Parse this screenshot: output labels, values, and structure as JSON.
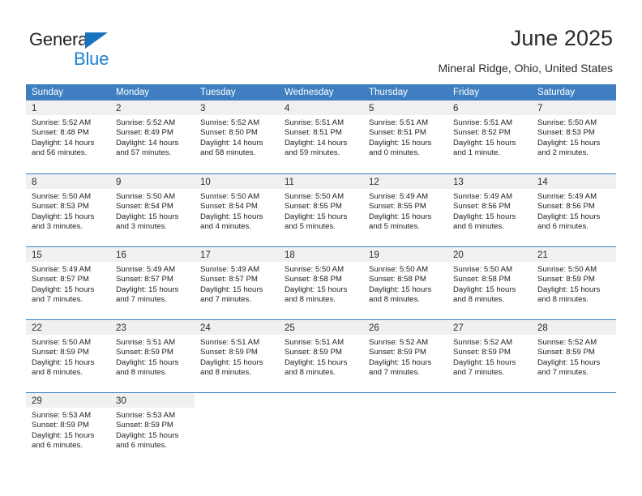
{
  "brand": {
    "name_part1": "General",
    "name_part2": "Blue",
    "logo_icon": "triangle-logo-icon"
  },
  "header": {
    "title": "June 2025",
    "subtitle": "Mineral Ridge, Ohio, United States"
  },
  "colors": {
    "header_blue": "#3f7fc1",
    "brand_blue": "#1b82d2",
    "daynum_band": "#f0f0f0",
    "text": "#222222"
  },
  "weekdays": [
    "Sunday",
    "Monday",
    "Tuesday",
    "Wednesday",
    "Thursday",
    "Friday",
    "Saturday"
  ],
  "weeks": [
    [
      {
        "day": "1",
        "sunrise": "Sunrise: 5:52 AM",
        "sunset": "Sunset: 8:48 PM",
        "daylight_1": "Daylight: 14 hours",
        "daylight_2": "and 56 minutes."
      },
      {
        "day": "2",
        "sunrise": "Sunrise: 5:52 AM",
        "sunset": "Sunset: 8:49 PM",
        "daylight_1": "Daylight: 14 hours",
        "daylight_2": "and 57 minutes."
      },
      {
        "day": "3",
        "sunrise": "Sunrise: 5:52 AM",
        "sunset": "Sunset: 8:50 PM",
        "daylight_1": "Daylight: 14 hours",
        "daylight_2": "and 58 minutes."
      },
      {
        "day": "4",
        "sunrise": "Sunrise: 5:51 AM",
        "sunset": "Sunset: 8:51 PM",
        "daylight_1": "Daylight: 14 hours",
        "daylight_2": "and 59 minutes."
      },
      {
        "day": "5",
        "sunrise": "Sunrise: 5:51 AM",
        "sunset": "Sunset: 8:51 PM",
        "daylight_1": "Daylight: 15 hours",
        "daylight_2": "and 0 minutes."
      },
      {
        "day": "6",
        "sunrise": "Sunrise: 5:51 AM",
        "sunset": "Sunset: 8:52 PM",
        "daylight_1": "Daylight: 15 hours",
        "daylight_2": "and 1 minute."
      },
      {
        "day": "7",
        "sunrise": "Sunrise: 5:50 AM",
        "sunset": "Sunset: 8:53 PM",
        "daylight_1": "Daylight: 15 hours",
        "daylight_2": "and 2 minutes."
      }
    ],
    [
      {
        "day": "8",
        "sunrise": "Sunrise: 5:50 AM",
        "sunset": "Sunset: 8:53 PM",
        "daylight_1": "Daylight: 15 hours",
        "daylight_2": "and 3 minutes."
      },
      {
        "day": "9",
        "sunrise": "Sunrise: 5:50 AM",
        "sunset": "Sunset: 8:54 PM",
        "daylight_1": "Daylight: 15 hours",
        "daylight_2": "and 3 minutes."
      },
      {
        "day": "10",
        "sunrise": "Sunrise: 5:50 AM",
        "sunset": "Sunset: 8:54 PM",
        "daylight_1": "Daylight: 15 hours",
        "daylight_2": "and 4 minutes."
      },
      {
        "day": "11",
        "sunrise": "Sunrise: 5:50 AM",
        "sunset": "Sunset: 8:55 PM",
        "daylight_1": "Daylight: 15 hours",
        "daylight_2": "and 5 minutes."
      },
      {
        "day": "12",
        "sunrise": "Sunrise: 5:49 AM",
        "sunset": "Sunset: 8:55 PM",
        "daylight_1": "Daylight: 15 hours",
        "daylight_2": "and 5 minutes."
      },
      {
        "day": "13",
        "sunrise": "Sunrise: 5:49 AM",
        "sunset": "Sunset: 8:56 PM",
        "daylight_1": "Daylight: 15 hours",
        "daylight_2": "and 6 minutes."
      },
      {
        "day": "14",
        "sunrise": "Sunrise: 5:49 AM",
        "sunset": "Sunset: 8:56 PM",
        "daylight_1": "Daylight: 15 hours",
        "daylight_2": "and 6 minutes."
      }
    ],
    [
      {
        "day": "15",
        "sunrise": "Sunrise: 5:49 AM",
        "sunset": "Sunset: 8:57 PM",
        "daylight_1": "Daylight: 15 hours",
        "daylight_2": "and 7 minutes."
      },
      {
        "day": "16",
        "sunrise": "Sunrise: 5:49 AM",
        "sunset": "Sunset: 8:57 PM",
        "daylight_1": "Daylight: 15 hours",
        "daylight_2": "and 7 minutes."
      },
      {
        "day": "17",
        "sunrise": "Sunrise: 5:49 AM",
        "sunset": "Sunset: 8:57 PM",
        "daylight_1": "Daylight: 15 hours",
        "daylight_2": "and 7 minutes."
      },
      {
        "day": "18",
        "sunrise": "Sunrise: 5:50 AM",
        "sunset": "Sunset: 8:58 PM",
        "daylight_1": "Daylight: 15 hours",
        "daylight_2": "and 8 minutes."
      },
      {
        "day": "19",
        "sunrise": "Sunrise: 5:50 AM",
        "sunset": "Sunset: 8:58 PM",
        "daylight_1": "Daylight: 15 hours",
        "daylight_2": "and 8 minutes."
      },
      {
        "day": "20",
        "sunrise": "Sunrise: 5:50 AM",
        "sunset": "Sunset: 8:58 PM",
        "daylight_1": "Daylight: 15 hours",
        "daylight_2": "and 8 minutes."
      },
      {
        "day": "21",
        "sunrise": "Sunrise: 5:50 AM",
        "sunset": "Sunset: 8:59 PM",
        "daylight_1": "Daylight: 15 hours",
        "daylight_2": "and 8 minutes."
      }
    ],
    [
      {
        "day": "22",
        "sunrise": "Sunrise: 5:50 AM",
        "sunset": "Sunset: 8:59 PM",
        "daylight_1": "Daylight: 15 hours",
        "daylight_2": "and 8 minutes."
      },
      {
        "day": "23",
        "sunrise": "Sunrise: 5:51 AM",
        "sunset": "Sunset: 8:59 PM",
        "daylight_1": "Daylight: 15 hours",
        "daylight_2": "and 8 minutes."
      },
      {
        "day": "24",
        "sunrise": "Sunrise: 5:51 AM",
        "sunset": "Sunset: 8:59 PM",
        "daylight_1": "Daylight: 15 hours",
        "daylight_2": "and 8 minutes."
      },
      {
        "day": "25",
        "sunrise": "Sunrise: 5:51 AM",
        "sunset": "Sunset: 8:59 PM",
        "daylight_1": "Daylight: 15 hours",
        "daylight_2": "and 8 minutes."
      },
      {
        "day": "26",
        "sunrise": "Sunrise: 5:52 AM",
        "sunset": "Sunset: 8:59 PM",
        "daylight_1": "Daylight: 15 hours",
        "daylight_2": "and 7 minutes."
      },
      {
        "day": "27",
        "sunrise": "Sunrise: 5:52 AM",
        "sunset": "Sunset: 8:59 PM",
        "daylight_1": "Daylight: 15 hours",
        "daylight_2": "and 7 minutes."
      },
      {
        "day": "28",
        "sunrise": "Sunrise: 5:52 AM",
        "sunset": "Sunset: 8:59 PM",
        "daylight_1": "Daylight: 15 hours",
        "daylight_2": "and 7 minutes."
      }
    ],
    [
      {
        "day": "29",
        "sunrise": "Sunrise: 5:53 AM",
        "sunset": "Sunset: 8:59 PM",
        "daylight_1": "Daylight: 15 hours",
        "daylight_2": "and 6 minutes."
      },
      {
        "day": "30",
        "sunrise": "Sunrise: 5:53 AM",
        "sunset": "Sunset: 8:59 PM",
        "daylight_1": "Daylight: 15 hours",
        "daylight_2": "and 6 minutes."
      },
      {
        "day": "",
        "sunrise": "",
        "sunset": "",
        "daylight_1": "",
        "daylight_2": ""
      },
      {
        "day": "",
        "sunrise": "",
        "sunset": "",
        "daylight_1": "",
        "daylight_2": ""
      },
      {
        "day": "",
        "sunrise": "",
        "sunset": "",
        "daylight_1": "",
        "daylight_2": ""
      },
      {
        "day": "",
        "sunrise": "",
        "sunset": "",
        "daylight_1": "",
        "daylight_2": ""
      },
      {
        "day": "",
        "sunrise": "",
        "sunset": "",
        "daylight_1": "",
        "daylight_2": ""
      }
    ]
  ]
}
